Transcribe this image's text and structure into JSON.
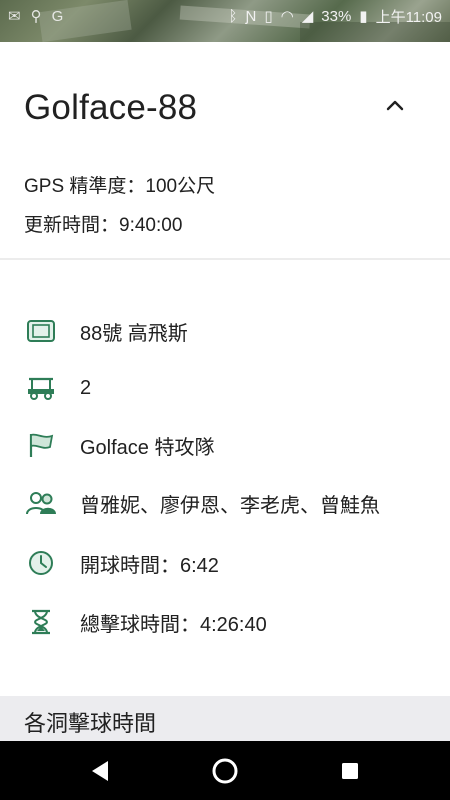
{
  "status_bar": {
    "battery": "33%",
    "time": "上午11:09",
    "icons": [
      "gmail-icon",
      "keyhole-icon",
      "g-icon",
      "bluetooth-icon",
      "nfc-icon",
      "vibrate-icon",
      "wifi-icon",
      "signal-icon",
      "battery-icon"
    ]
  },
  "device": {
    "title": "Golface-88",
    "gps_accuracy": "GPS 精準度：100公尺",
    "update_time": "更新時間：9:40:00"
  },
  "details": {
    "caddie": "88號 高飛斯",
    "cart": "2",
    "team": "Golface 特攻隊",
    "players": "曾雅妮、廖伊恩、李老虎、曾鮭魚",
    "tee_time": "開球時間：6:42",
    "total_time": "總擊球時間：4:26:40"
  },
  "section": {
    "hole_times": "各洞擊球時間"
  },
  "colors": {
    "icon_green": "#2e7d57",
    "divider": "#ececec",
    "section_bg": "#ececef"
  }
}
